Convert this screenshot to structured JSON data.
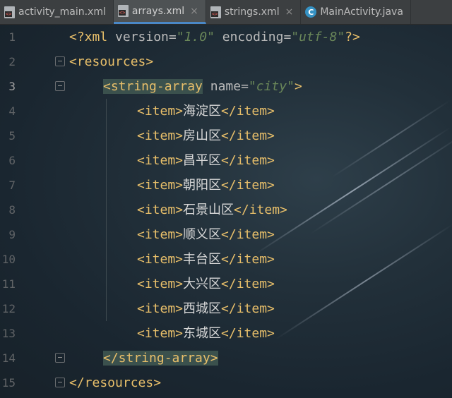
{
  "tabs": [
    {
      "label": "activity_main.xml",
      "icon": "xml-file-icon",
      "closable": false,
      "active": false
    },
    {
      "label": "arrays.xml",
      "icon": "xml-file-icon",
      "closable": true,
      "active": true
    },
    {
      "label": "strings.xml",
      "icon": "xml-file-icon",
      "closable": true,
      "active": false
    },
    {
      "label": "MainActivity.java",
      "icon": "java-class-icon",
      "closable": false,
      "active": false
    }
  ],
  "java_icon_letter": "C",
  "close_glyph": "×",
  "line_numbers": [
    "1",
    "2",
    "3",
    "4",
    "5",
    "6",
    "7",
    "8",
    "9",
    "10",
    "11",
    "12",
    "13",
    "14",
    "15"
  ],
  "current_line": "3",
  "code": {
    "xml_decl": {
      "open": "<?xml ",
      "a1": "version=",
      "v1": "\"1.0\"",
      "a2": " encoding=",
      "v2": "\"utf-8\"",
      "close": "?>"
    },
    "resources_open": "<resources>",
    "array_open": {
      "tag": "<string-array",
      "attr": " name=",
      "value": "\"city\"",
      "close": ">"
    },
    "items": [
      {
        "open": "<item>",
        "text": "海淀区",
        "close": "</item>"
      },
      {
        "open": "<item>",
        "text": "房山区",
        "close": "</item>"
      },
      {
        "open": "<item>",
        "text": "昌平区",
        "close": "</item>"
      },
      {
        "open": "<item>",
        "text": "朝阳区",
        "close": "</item>"
      },
      {
        "open": "<item>",
        "text": "石景山区",
        "close": "</item>"
      },
      {
        "open": "<item>",
        "text": "顺义区",
        "close": "</item>"
      },
      {
        "open": "<item>",
        "text": "丰台区",
        "close": "</item>"
      },
      {
        "open": "<item>",
        "text": "大兴区",
        "close": "</item>"
      },
      {
        "open": "<item>",
        "text": "西城区",
        "close": "</item>"
      },
      {
        "open": "<item>",
        "text": "东城区",
        "close": "</item>"
      }
    ],
    "array_close": "</string-array>",
    "resources_close": "</resources>"
  },
  "colors": {
    "tag": "#e8bf6a",
    "attr_value": "#6a8759",
    "tab_active_underline": "#4a88c7"
  }
}
